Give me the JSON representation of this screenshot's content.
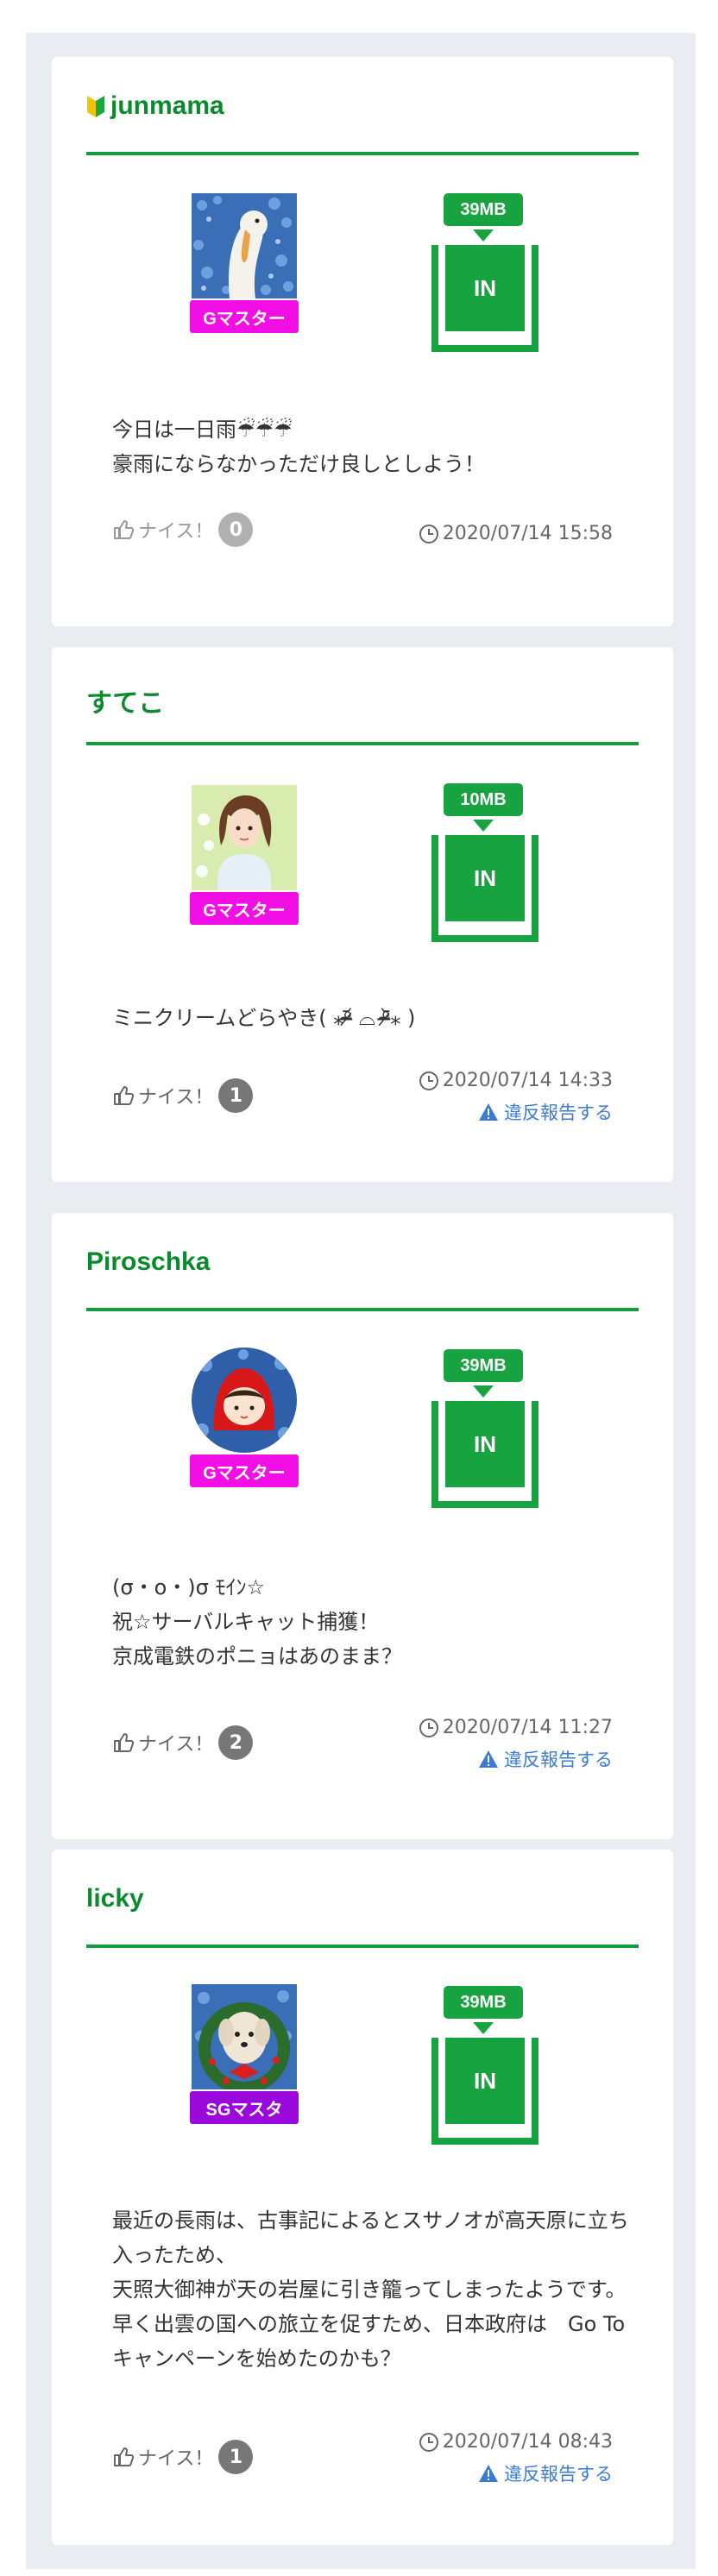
{
  "posts": [
    {
      "username": "junmama",
      "beginner": true,
      "avatar_icon": "swan-avatar",
      "rank": "Gマスター",
      "size": "39MB",
      "in_label": "IN",
      "message": "今日は一日雨☔☔☔\n豪雨にならなかっただけ良しとしよう！",
      "nice_label": "ナイス！",
      "nice_count": "0",
      "timestamp": "2020/07/14 15:58",
      "report": ""
    },
    {
      "username": "すてこ",
      "beginner": false,
      "avatar_icon": "girl-illustration-avatar",
      "rank": "Gマスター",
      "size": "10MB",
      "in_label": "IN",
      "message": "ミニクリームどらやき( ⁎ᵒ̴̶̷᷄ ⌓ ᵒ̴̶̷᷅⁎ )",
      "nice_label": "ナイス！",
      "nice_count": "1",
      "timestamp": "2020/07/14 14:33",
      "report": "違反報告する"
    },
    {
      "username": "Piroschka",
      "beginner": false,
      "avatar_icon": "red-hood-avatar",
      "rank": "Gマスター",
      "size": "39MB",
      "in_label": "IN",
      "message": "(σ・ο・)σ ﾓｲﾝ☆\n祝☆サーバルキャット捕獲！\n京成電鉄のポニョはあのまま？",
      "nice_label": "ナイス！",
      "nice_count": "2",
      "timestamp": "2020/07/14 11:27",
      "report": "違反報告する"
    },
    {
      "username": "licky",
      "beginner": false,
      "avatar_icon": "dog-wreath-avatar",
      "rank": "SGマスタ",
      "size": "39MB",
      "in_label": "IN",
      "message": "最近の長雨は、古事記によるとスサノオが高天原に立ち入ったため、\n天照大御神が天の岩屋に引き籠ってしまったようです。\n早く出雲の国への旅立を促すため、日本政府は　Go To キャンペーンを始めたのかも？",
      "nice_label": "ナイス！",
      "nice_count": "1",
      "timestamp": "2020/07/14 08:43",
      "report": "違反報告する"
    }
  ],
  "colors": {
    "accent_green": "#16a340",
    "username_green": "#0b8a2d",
    "rank_magenta": "#f10fe6",
    "rank_purple": "#9a08dc",
    "report_blue": "#3a7bd5"
  }
}
